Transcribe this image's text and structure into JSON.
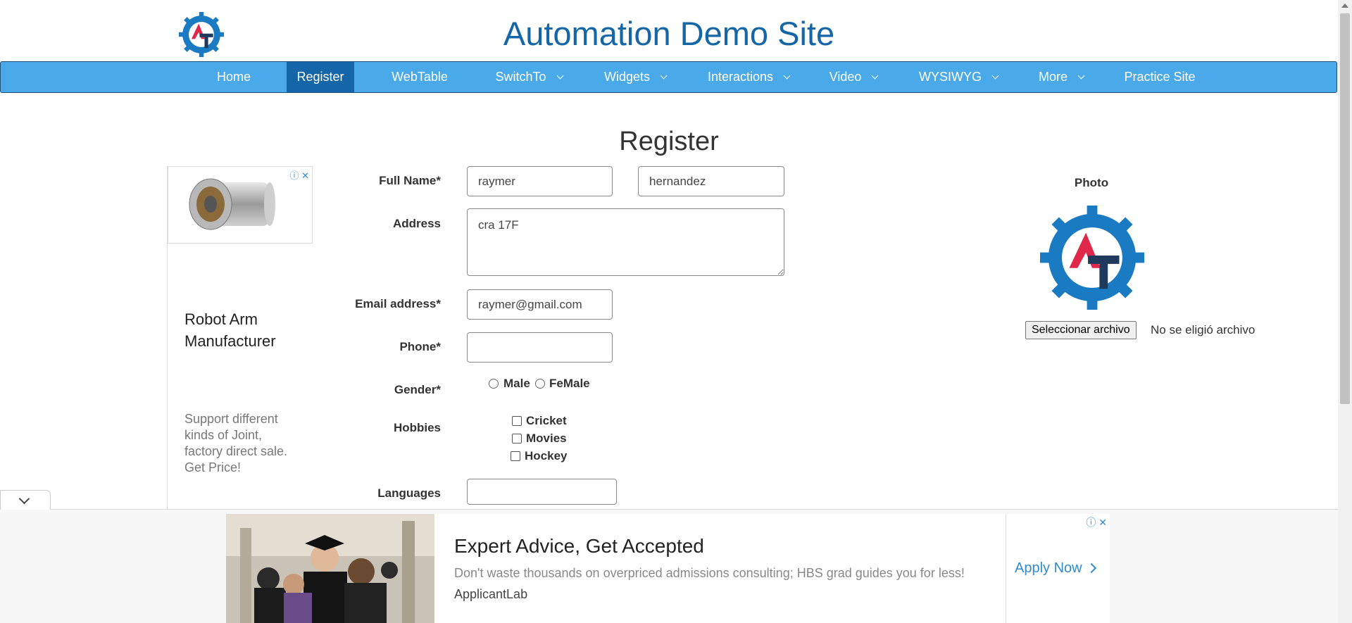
{
  "header": {
    "site_title": "Automation Demo Site"
  },
  "nav": {
    "items": [
      {
        "label": "Home"
      },
      {
        "label": "Register"
      },
      {
        "label": "WebTable"
      },
      {
        "label": "SwitchTo"
      },
      {
        "label": "Widgets"
      },
      {
        "label": "Interactions"
      },
      {
        "label": "Video"
      },
      {
        "label": "WYSIWYG"
      },
      {
        "label": "More"
      },
      {
        "label": "Practice Site"
      }
    ],
    "active": "Register",
    "active_color": "#1466a8",
    "bar_color": "#4aa9e8"
  },
  "page": {
    "title": "Register"
  },
  "ad_left": {
    "adchoices": "ⓘ ✕",
    "headline": "Robot Arm Manufacturer",
    "description": "Support different kinds of Joint, factory direct sale. Get Price!"
  },
  "form": {
    "full_name_label": "Full Name*",
    "first_name_value": "raymer",
    "last_name_value": "hernandez",
    "address_label": "Address",
    "address_value": "cra 17F",
    "email_label": "Email address*",
    "email_value": "raymer@gmail.com",
    "phone_label": "Phone*",
    "phone_value": "",
    "gender_label": "Gender*",
    "gender_options": [
      "Male",
      "FeMale"
    ],
    "hobbies_label": "Hobbies",
    "hobbies": [
      "Cricket",
      "Movies",
      "Hockey"
    ],
    "languages_label": "Languages",
    "languages_value": ""
  },
  "photo": {
    "label": "Photo",
    "file_button": "Seleccionar archivo",
    "file_status": "No se eligió archivo"
  },
  "bottom_ad": {
    "adchoices": "ⓘ ✕",
    "headline": "Expert Advice, Get Accepted",
    "description": "Don't waste thousands on overpriced admissions consulting; HBS grad guides you for less!",
    "brand": "ApplicantLab",
    "cta": "Apply Now"
  }
}
